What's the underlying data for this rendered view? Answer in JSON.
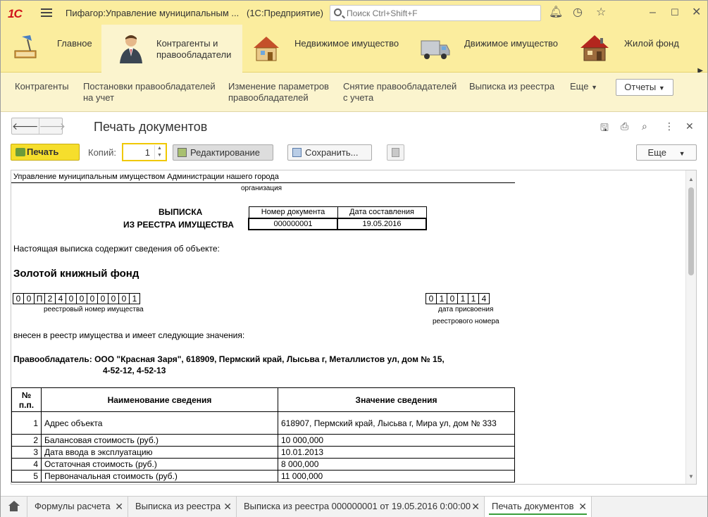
{
  "titlebar": {
    "logo": "1С",
    "title": "Пифагор:Управление муниципальным ...",
    "subtitle": "(1С:Предприятие)",
    "search_placeholder": "Поиск Ctrl+Shift+F",
    "icons": [
      "bell-icon",
      "history-icon",
      "star-icon",
      "minimize-icon",
      "maximize-icon",
      "close-icon"
    ]
  },
  "sections": [
    {
      "label": "Главное",
      "icon": "desk-lamp-icon"
    },
    {
      "label": "Контрагенты и правообладатели",
      "icon": "person-icon",
      "active": true
    },
    {
      "label": "Недвижимое имущество",
      "icon": "house-icon"
    },
    {
      "label": "Движимое имущество",
      "icon": "truck-icon"
    },
    {
      "label": "Жилой фонд",
      "icon": "cottage-icon"
    }
  ],
  "commands": [
    "Контрагенты",
    "Постановки правообладателей на учет",
    "Изменение параметров правообладателей",
    "Снятие правообладателей с учета",
    "Выписка из реестра",
    "Еще",
    "Отчеты"
  ],
  "form": {
    "title": "Печать документов",
    "print_label": "Печать",
    "copies_label": "Копий:",
    "copies_value": "1",
    "edit_label": "Редактирование",
    "save_label": "Сохранить...",
    "more_label": "Еще"
  },
  "document": {
    "org_name": "Управление муниципальным имуществом Администрации нашего города",
    "org_caption": "организация",
    "heading_1": "ВЫПИСКА",
    "heading_2": "ИЗ РЕЕСТРА ИМУЩЕСТВА",
    "doc_number_label": "Номер документа",
    "doc_date_label": "Дата составления",
    "doc_number": "000000001",
    "doc_date": "19.05.2016",
    "intro": "Настоящая выписка содержит сведения об объекте:",
    "object_name": "Золотой книжный фонд",
    "reg_number": [
      "0",
      "0",
      "П",
      "2",
      "4",
      "0",
      "0",
      "0",
      "0",
      "0",
      "0",
      "1"
    ],
    "reg_number_caption": "реестровый номер имущества",
    "reg_date": [
      "0",
      "1",
      "0",
      "1",
      "1",
      "4"
    ],
    "reg_date_caption_1": "дата присвоения",
    "reg_date_caption_2": "реестрового номера",
    "registered_text": "внесен в реестр имущества и имеет следующие значения:",
    "owner_line_1": "Правообладатель: ООО \"Красная Заря\", 618909, Пермский край, Лысьва г, Металлистов ул, дом № 15,",
    "owner_line_2": "4-52-12, 4-52-13",
    "table_headers": {
      "num": "№ п.п.",
      "name": "Наименование сведения",
      "value": "Значение сведения"
    },
    "rows": [
      {
        "n": "1",
        "name": "Адрес объекта",
        "value": "618907, Пермский край, Лысьва г, Мира ул, дом № 333"
      },
      {
        "n": "2",
        "name": "Балансовая стоимость (руб.)",
        "value": "10 000,000"
      },
      {
        "n": "3",
        "name": "Дата ввода в эксплуатацию",
        "value": "10.01.2013"
      },
      {
        "n": "4",
        "name": "Остаточная стоимость (руб.)",
        "value": "8 000,000"
      },
      {
        "n": "5",
        "name": "Первоначальная стоимость (руб.)",
        "value": "11 000,000"
      }
    ]
  },
  "tabs": [
    {
      "label": "Формулы расчета"
    },
    {
      "label": "Выписка из реестра"
    },
    {
      "label": "Выписка из реестра 000000001 от 19.05.2016 0:00:00"
    },
    {
      "label": "Печать документов",
      "active": true
    }
  ],
  "colors": {
    "accent_yellow": "#fbed9e",
    "panel_light": "#fbf4ce",
    "print_button": "#f6de2c",
    "active_tab_underline": "#3a9d3a"
  }
}
